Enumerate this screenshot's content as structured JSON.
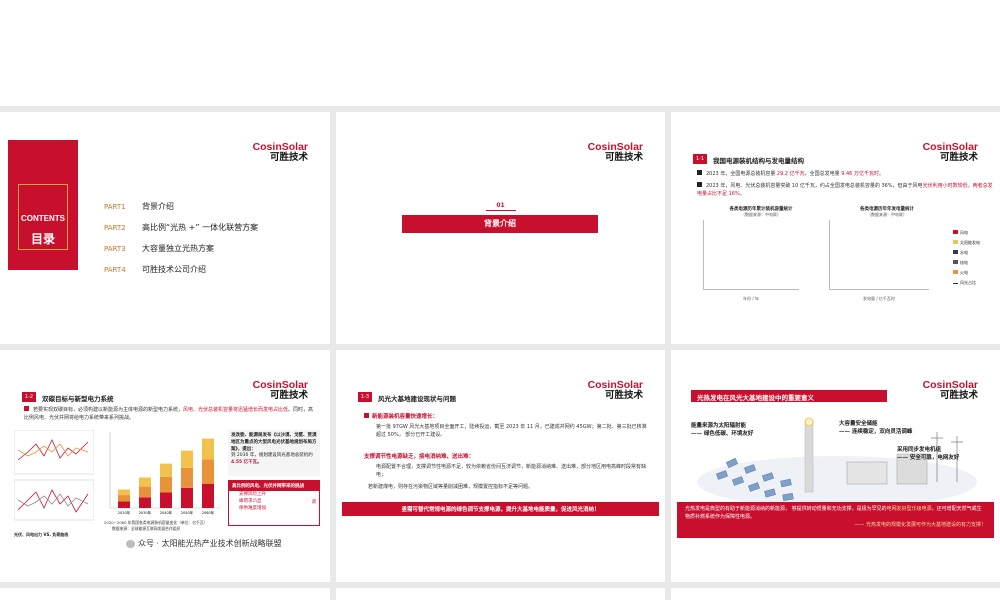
{
  "brand": {
    "en": "CosinSolar",
    "cn": "可胜技术"
  },
  "contents": {
    "label_en": "CONTENTS",
    "label_cn": "目录",
    "parts": [
      {
        "num": "PART1",
        "title": "背景介绍"
      },
      {
        "num": "PART2",
        "title": "高比例“光热 +” 一体化联营方案"
      },
      {
        "num": "PART3",
        "title": "大容量独立光热方案"
      },
      {
        "num": "PART4",
        "title": "可胜技术公司介绍"
      }
    ]
  },
  "section": {
    "num": "01",
    "title": "背景介绍"
  },
  "slide3": {
    "tag": "1-1",
    "title": "我国电源装机结构与发电量结构",
    "bullet1_a": "2023 年，全国电源总装机容量 ",
    "bullet1_b": "29.2 亿千瓦",
    "bullet1_c": "，全国总发电量 ",
    "bullet1_d": "9.46 万亿千瓦时",
    "bullet1_e": "。",
    "bullet2_a": "2023 年，风电、光伏总装机容量突破 10 亿千瓦，约占全国发电总装机容量的 36%，但由于风电",
    "bullet2_b": "光伏利用小时数较低，两者总发电量占比不足 16%",
    "bullet2_c": "。",
    "chart1_title": "各类电源历年累计装机容量统计",
    "chart1_sub": "（数据来源：中电联）",
    "chart2_title": "各类电源历年年发电量统计",
    "chart2_sub": "（数据来源：中电联）",
    "chart1_xlabel": "年份 / 年",
    "chart2_xlabel": "发电量 / 亿千瓦时",
    "legend": [
      "风电",
      "太阳能发电",
      "水电",
      "核电",
      "火电",
      "风光占比"
    ]
  },
  "slide4": {
    "tag": "1-2",
    "title": "双碳目标与新型电力系统",
    "bullet_a": "若要实现双碳目标，必须构建以新能源为主体电源的新型电力系统，",
    "bullet_b": "风电、光伏总装机容量将迅猛增长而发电占比低",
    "bullet_c": "。同时，高比例风电、光伏并网将给电力系统带来系列挑战。",
    "box1": "发改委、能源局发布《以沙漠、戈壁、荒漠地区为重点的大型风电光伏基地规划布局方案》，提出：",
    "box1_b": "到 2030 年，规划建设风光基地总装机约 ",
    "box1_c": "4.55 亿千瓦",
    "box1_d": "。",
    "box2_title": "高比例的风电、光伏并网带来的挑战",
    "box2_items": [
      "支撑风险上升",
      "峰荷求凸显",
      "保供难度增加"
    ],
    "box2_side": "调",
    "caption_left": "光伏、风电出力 VS. 负荷曲线",
    "caption_right": "2020~2060 年我国各类电源装机容量变化（单位：亿千瓦）",
    "caption_right2": "数据来源：全球能源互联网发展合作组织",
    "watermark": "众号 · 太阳能光热产业技术创新战略联盟",
    "chart_years": [
      "2020年",
      "2030年",
      "2040年",
      "2050年",
      "2060年"
    ],
    "chart_values": [
      20,
      33,
      48,
      62,
      75
    ]
  },
  "slide5": {
    "tag": "1-3",
    "title": "风光大基地建设现状与问题",
    "h1": "新能源装机容量快速增长：",
    "p1": "第一批 97GW   风光大基地项目全面开工，陆续投运，截至 2023 年 11 月，已建成并网约 45GW；第二批、第三批已核准超过 50%，   部分已开工建设。",
    "h2": "支撑调节性电源缺乏，接电消纳难、送出难：",
    "p2a": "电源配置不合理，支撑调节性电源不足，较为依赖省份间互济调节，新能源消纳难、送出难，部分地区用电高峰时段常有缺电；",
    "p2b": "若新建煤电，则存在污染物区域等量削减困难，规模置控指标不足等问题。",
    "banner": "亟需可替代常规电源的绿色调节支撑电源，提升大基地电能质量，促进风光消纳！"
  },
  "slide6": {
    "title": "光热发电在风光大基地建设中的重要意义",
    "c1": "能量来源为太阳辐射能",
    "c1b": "—— 绿色低碳、环境友好",
    "c2": "大容量安全储能",
    "c2b": "—— 连续稳定，双向灵活调峰",
    "c3": "采用同步发电机组",
    "c3b": "—— 安全可靠，电网友好",
    "bottom_a": "光热发电是典型的有助于新能源消纳的新能源，   够提供转动惯量和无功支撑，是极为罕见的",
    "bottom_b": "电网友好型乐级电源",
    "bottom_c": "，还可增配天然气或生物质补燃系统作为保障性电源。",
    "bottom_d": "—— 光热发电的规模化发展可作为大基地建设的有力支撑！"
  },
  "colors": {
    "accent": "#c8102e",
    "orange": "#e8923a",
    "gold": "#f2c14e",
    "navy": "#2e3a59"
  }
}
